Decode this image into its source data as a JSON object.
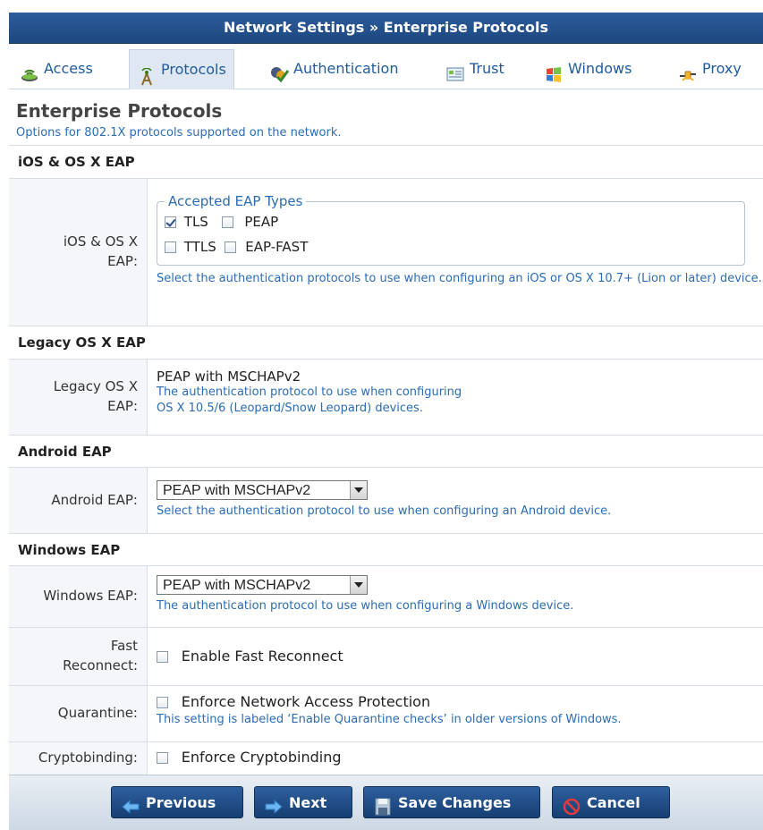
{
  "header": {
    "title": "Network Settings » Enterprise Protocols"
  },
  "tabs": [
    {
      "label": "Access",
      "icon": "access-icon"
    },
    {
      "label": "Protocols",
      "icon": "protocols-icon"
    },
    {
      "label": "Authentication",
      "icon": "authentication-icon"
    },
    {
      "label": "Trust",
      "icon": "trust-icon"
    },
    {
      "label": "Windows",
      "icon": "windows-icon"
    },
    {
      "label": "Proxy",
      "icon": "proxy-icon"
    }
  ],
  "page": {
    "title": "Enterprise Protocols",
    "subtitle": "Options for 802.1X protocols supported on the network."
  },
  "ios": {
    "section": "iOS & OS X EAP",
    "label": "iOS & OS X EAP:",
    "legend": "Accepted EAP Types",
    "options": [
      {
        "label": "TLS",
        "checked": true
      },
      {
        "label": "PEAP",
        "checked": false
      },
      {
        "label": "TTLS",
        "checked": false
      },
      {
        "label": "EAP-FAST",
        "checked": false
      }
    ],
    "hint": "Select the authentication protocols to use when configuring an iOS or OS X 10.7+ (Lion or later) device."
  },
  "legacy": {
    "section": "Legacy OS X EAP",
    "label": "Legacy OS X EAP:",
    "value": "PEAP with MSCHAPv2",
    "hint_line1": "The authentication protocol to use when configuring",
    "hint_line2": "OS X 10.5/6 (Leopard/Snow Leopard) devices."
  },
  "android": {
    "section": "Android EAP",
    "label": "Android EAP:",
    "selected": "PEAP with MSCHAPv2",
    "hint": "Select the authentication protocol to use when configuring an Android device."
  },
  "windows": {
    "section": "Windows EAP",
    "label": "Windows EAP:",
    "selected": "PEAP with MSCHAPv2",
    "hint": "The authentication protocol to use when configuring a Windows device."
  },
  "fast_reconnect": {
    "label_line1": "Fast",
    "label_line2": "Reconnect:",
    "option": "Enable Fast Reconnect",
    "checked": false
  },
  "quarantine": {
    "label": "Quarantine:",
    "option": "Enforce Network Access Protection",
    "checked": false,
    "hint": "This setting is labeled ‘Enable Quarantine checks’ in older versions of Windows."
  },
  "cryptobinding": {
    "label": "Cryptobinding:",
    "option": "Enforce Cryptobinding",
    "checked": false
  },
  "footer": {
    "previous": "Previous",
    "next": "Next",
    "save": "Save Changes",
    "cancel": "Cancel"
  },
  "colors": {
    "title_bar": "#1c477f",
    "link_blue": "#2b6cb5",
    "label_bg": "#f4f6f9"
  }
}
